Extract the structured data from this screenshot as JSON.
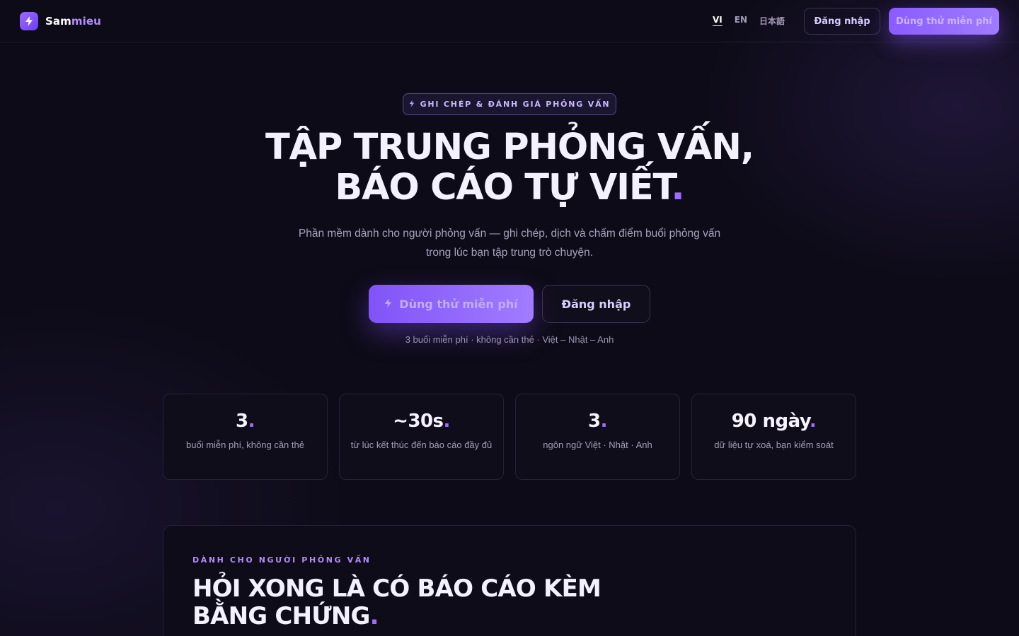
{
  "colors": {
    "background": "#0d0b17",
    "accent": "#8a5cff",
    "accent_light": "#b48cff",
    "text": "#f4f1ff",
    "muted": "#a7a1bd"
  },
  "nav": {
    "logo_icon": "bolt-icon",
    "brand_part1": "Sam",
    "brand_part2": "mieu",
    "languages": [
      {
        "label": "VI",
        "active": true
      },
      {
        "label": "EN",
        "active": false
      },
      {
        "label": "日本語",
        "active": false
      }
    ],
    "login_label": "Đăng nhập",
    "try_label": "Dùng thử miễn phí"
  },
  "hero": {
    "pill_icon": "bolt-icon",
    "pill_text": "GHI CHÉP & ĐÁNH GIÁ PHỎNG VẤN",
    "title_line1": "TẬP TRUNG PHỎNG VẤN,",
    "title_line2": "BÁO CÁO TỰ VIẾT",
    "title_dot": ".",
    "subtitle": "Phần mềm dành cho người phỏng vấn — ghi chép, dịch và chấm điểm buổi phỏng vấn trong lúc bạn tập trung trò chuyện.",
    "primary_cta": "Dùng thử miễn phí",
    "secondary_cta": "Đăng nhập",
    "note": "3 buổi miễn phí · không cần thẻ · Việt – Nhật – Anh"
  },
  "stats": [
    {
      "value": "3",
      "label": "buổi miễn phí, không cần thẻ"
    },
    {
      "value": "~30s",
      "label": "từ lúc kết thúc đến báo cáo đầy đủ"
    },
    {
      "value": "3",
      "label": "ngôn ngữ Việt · Nhật · Anh"
    },
    {
      "value": "90 ngày",
      "label": "dữ liệu tự xoá, bạn kiểm soát"
    }
  ],
  "section": {
    "eyebrow": "DÀNH CHO NGƯỜI PHỎNG VẤN",
    "title_line1": "HỎI XONG LÀ CÓ BÁO CÁO KÈM",
    "title_line2": "BẰNG CHỨNG",
    "title_dot": "."
  }
}
